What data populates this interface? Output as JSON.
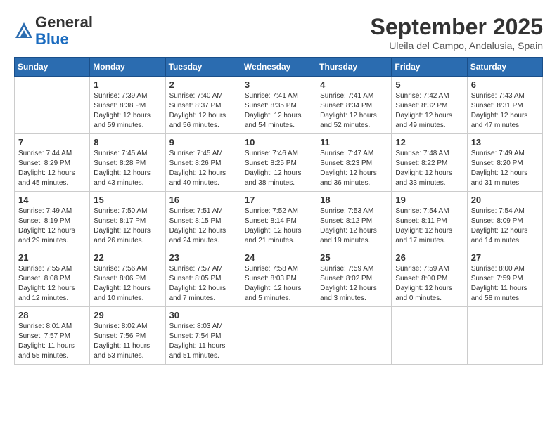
{
  "header": {
    "logo_general": "General",
    "logo_blue": "Blue",
    "month_title": "September 2025",
    "location": "Uleila del Campo, Andalusia, Spain"
  },
  "days_of_week": [
    "Sunday",
    "Monday",
    "Tuesday",
    "Wednesday",
    "Thursday",
    "Friday",
    "Saturday"
  ],
  "weeks": [
    [
      {
        "day": "",
        "info": ""
      },
      {
        "day": "1",
        "info": "Sunrise: 7:39 AM\nSunset: 8:38 PM\nDaylight: 12 hours\nand 59 minutes."
      },
      {
        "day": "2",
        "info": "Sunrise: 7:40 AM\nSunset: 8:37 PM\nDaylight: 12 hours\nand 56 minutes."
      },
      {
        "day": "3",
        "info": "Sunrise: 7:41 AM\nSunset: 8:35 PM\nDaylight: 12 hours\nand 54 minutes."
      },
      {
        "day": "4",
        "info": "Sunrise: 7:41 AM\nSunset: 8:34 PM\nDaylight: 12 hours\nand 52 minutes."
      },
      {
        "day": "5",
        "info": "Sunrise: 7:42 AM\nSunset: 8:32 PM\nDaylight: 12 hours\nand 49 minutes."
      },
      {
        "day": "6",
        "info": "Sunrise: 7:43 AM\nSunset: 8:31 PM\nDaylight: 12 hours\nand 47 minutes."
      }
    ],
    [
      {
        "day": "7",
        "info": "Sunrise: 7:44 AM\nSunset: 8:29 PM\nDaylight: 12 hours\nand 45 minutes."
      },
      {
        "day": "8",
        "info": "Sunrise: 7:45 AM\nSunset: 8:28 PM\nDaylight: 12 hours\nand 43 minutes."
      },
      {
        "day": "9",
        "info": "Sunrise: 7:45 AM\nSunset: 8:26 PM\nDaylight: 12 hours\nand 40 minutes."
      },
      {
        "day": "10",
        "info": "Sunrise: 7:46 AM\nSunset: 8:25 PM\nDaylight: 12 hours\nand 38 minutes."
      },
      {
        "day": "11",
        "info": "Sunrise: 7:47 AM\nSunset: 8:23 PM\nDaylight: 12 hours\nand 36 minutes."
      },
      {
        "day": "12",
        "info": "Sunrise: 7:48 AM\nSunset: 8:22 PM\nDaylight: 12 hours\nand 33 minutes."
      },
      {
        "day": "13",
        "info": "Sunrise: 7:49 AM\nSunset: 8:20 PM\nDaylight: 12 hours\nand 31 minutes."
      }
    ],
    [
      {
        "day": "14",
        "info": "Sunrise: 7:49 AM\nSunset: 8:19 PM\nDaylight: 12 hours\nand 29 minutes."
      },
      {
        "day": "15",
        "info": "Sunrise: 7:50 AM\nSunset: 8:17 PM\nDaylight: 12 hours\nand 26 minutes."
      },
      {
        "day": "16",
        "info": "Sunrise: 7:51 AM\nSunset: 8:15 PM\nDaylight: 12 hours\nand 24 minutes."
      },
      {
        "day": "17",
        "info": "Sunrise: 7:52 AM\nSunset: 8:14 PM\nDaylight: 12 hours\nand 21 minutes."
      },
      {
        "day": "18",
        "info": "Sunrise: 7:53 AM\nSunset: 8:12 PM\nDaylight: 12 hours\nand 19 minutes."
      },
      {
        "day": "19",
        "info": "Sunrise: 7:54 AM\nSunset: 8:11 PM\nDaylight: 12 hours\nand 17 minutes."
      },
      {
        "day": "20",
        "info": "Sunrise: 7:54 AM\nSunset: 8:09 PM\nDaylight: 12 hours\nand 14 minutes."
      }
    ],
    [
      {
        "day": "21",
        "info": "Sunrise: 7:55 AM\nSunset: 8:08 PM\nDaylight: 12 hours\nand 12 minutes."
      },
      {
        "day": "22",
        "info": "Sunrise: 7:56 AM\nSunset: 8:06 PM\nDaylight: 12 hours\nand 10 minutes."
      },
      {
        "day": "23",
        "info": "Sunrise: 7:57 AM\nSunset: 8:05 PM\nDaylight: 12 hours\nand 7 minutes."
      },
      {
        "day": "24",
        "info": "Sunrise: 7:58 AM\nSunset: 8:03 PM\nDaylight: 12 hours\nand 5 minutes."
      },
      {
        "day": "25",
        "info": "Sunrise: 7:59 AM\nSunset: 8:02 PM\nDaylight: 12 hours\nand 3 minutes."
      },
      {
        "day": "26",
        "info": "Sunrise: 7:59 AM\nSunset: 8:00 PM\nDaylight: 12 hours\nand 0 minutes."
      },
      {
        "day": "27",
        "info": "Sunrise: 8:00 AM\nSunset: 7:59 PM\nDaylight: 11 hours\nand 58 minutes."
      }
    ],
    [
      {
        "day": "28",
        "info": "Sunrise: 8:01 AM\nSunset: 7:57 PM\nDaylight: 11 hours\nand 55 minutes."
      },
      {
        "day": "29",
        "info": "Sunrise: 8:02 AM\nSunset: 7:56 PM\nDaylight: 11 hours\nand 53 minutes."
      },
      {
        "day": "30",
        "info": "Sunrise: 8:03 AM\nSunset: 7:54 PM\nDaylight: 11 hours\nand 51 minutes."
      },
      {
        "day": "",
        "info": ""
      },
      {
        "day": "",
        "info": ""
      },
      {
        "day": "",
        "info": ""
      },
      {
        "day": "",
        "info": ""
      }
    ]
  ]
}
